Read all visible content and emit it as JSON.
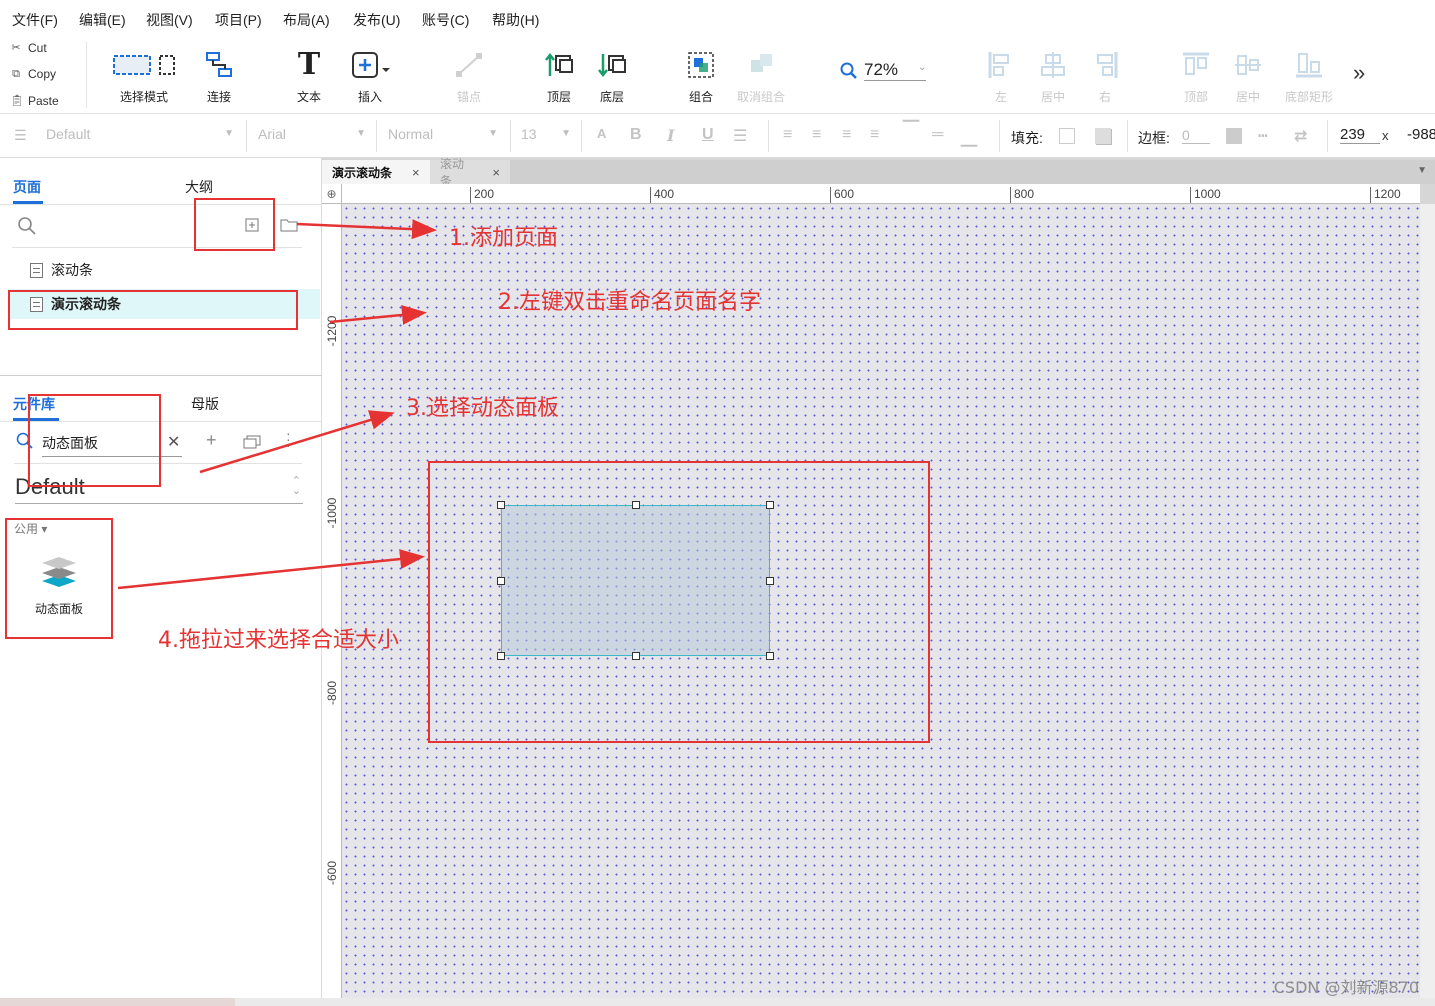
{
  "menu": [
    "文件(F)",
    "编辑(E)",
    "视图(V)",
    "项目(P)",
    "布局(A)",
    "发布(U)",
    "账号(C)",
    "帮助(H)"
  ],
  "clipboard": {
    "cut": "Cut",
    "copy": "Copy",
    "paste": "Paste"
  },
  "toolbar": {
    "select_mode": "选择模式",
    "connect": "连接",
    "text": "文本",
    "insert": "插入",
    "anchor": "锚点",
    "top_layer": "顶层",
    "bottom_layer": "底层",
    "group": "组合",
    "ungroup": "取消组合",
    "zoom": "72%",
    "align_left": "左",
    "align_center": "居中",
    "align_right": "右",
    "align_top": "顶部",
    "align_middle": "居中",
    "align_bottom": "底部矩形",
    "more": "»"
  },
  "format": {
    "style": "Default",
    "font": "Arial",
    "weight": "Normal",
    "size": "13",
    "fill_label": "填充:",
    "border_label": "边框:",
    "border_value": "0",
    "x_value": "239",
    "x_sep": "x",
    "y_value": "-988"
  },
  "left": {
    "tab_pages": "页面",
    "tab_outline": "大纲",
    "pages": [
      "滚动条",
      "演示滚动条"
    ],
    "tab_library": "元件库",
    "tab_masters": "母版",
    "search_value": "动态面板",
    "library_name": "Default",
    "category": "公用 ▾",
    "widget_label": "动态面板"
  },
  "doc_tabs": [
    "演示滚动条",
    "滚动条"
  ],
  "ruler": {
    "h": [
      "200",
      "400",
      "600",
      "800",
      "1000",
      "1200"
    ],
    "v": [
      "-1200",
      "-1000",
      "-800",
      "-600"
    ]
  },
  "annotations": {
    "a1": "1.添加页面",
    "a2": "2.左键双击重命名页面名字",
    "a3": "3.选择动态面板",
    "a4": "4.拖拉过来选择合适大小"
  },
  "watermark": "CSDN @刘新源870",
  "colors": {
    "accent": "#1e6fd9",
    "annotation": "#e53333",
    "selection": "#3bb8c9"
  }
}
